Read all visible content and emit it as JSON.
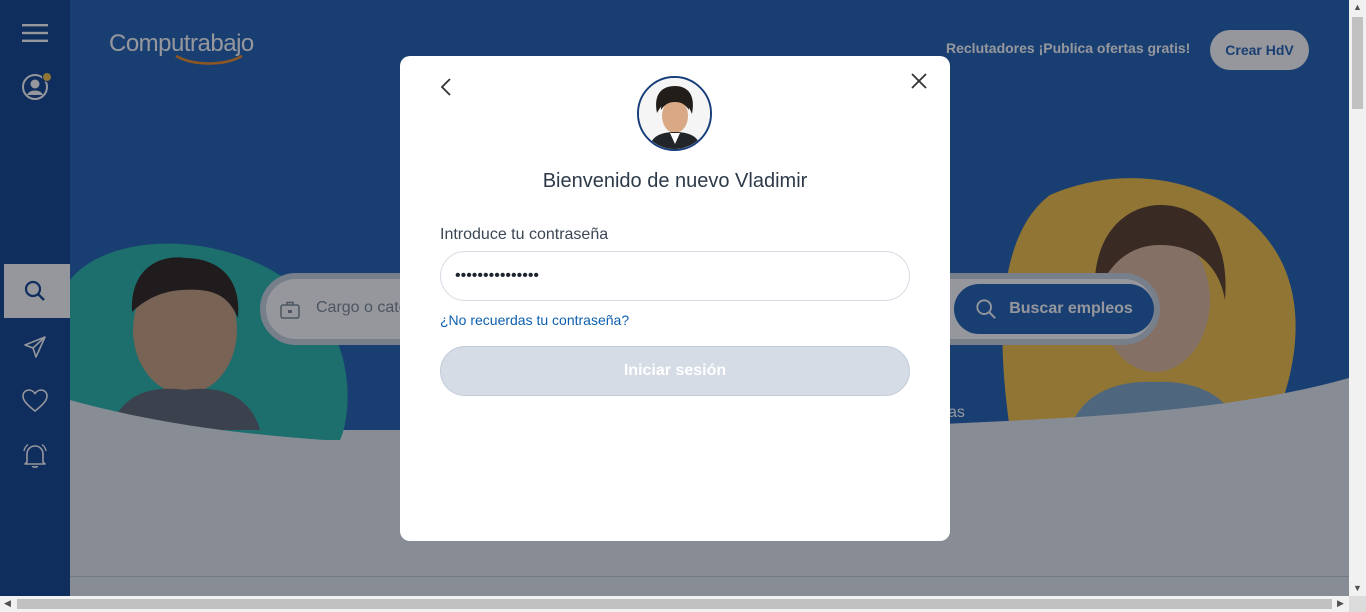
{
  "header": {
    "logo": "Computrabajo",
    "recruiters_link": "Reclutadores ¡Publica ofertas gratis!",
    "create_cv_button": "Crear HdV"
  },
  "search": {
    "placeholder": "Cargo o cate",
    "button_label": "Buscar empleos"
  },
  "hero": {
    "partial_text": "as"
  },
  "sidebar": {
    "items": [
      "menu-icon",
      "user-icon",
      "search-icon",
      "send-icon",
      "heart-icon",
      "bell-icon"
    ]
  },
  "modal": {
    "title": "Bienvenido de nuevo Vladimir",
    "password_label": "Introduce tu contraseña",
    "password_value": "•••••••••••••••",
    "forgot_link": "¿No recuerdas tu contraseña?",
    "login_button": "Iniciar sesión"
  },
  "colors": {
    "sidebar": "#0c3f8c",
    "hero": "#1e5fb3",
    "link": "#0c5fb0",
    "disabled_button": "#d5dce6"
  }
}
